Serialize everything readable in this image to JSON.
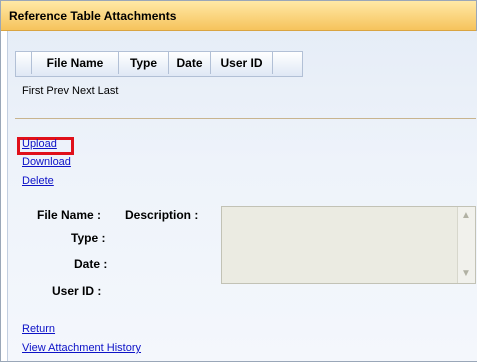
{
  "window": {
    "title": "Reference Table Attachments"
  },
  "table": {
    "columns": [
      "File Name",
      "Type",
      "Date",
      "User ID"
    ]
  },
  "pager": {
    "first": "First",
    "prev": "Prev",
    "next": "Next",
    "last": "Last"
  },
  "actions": {
    "upload": "Upload",
    "download": "Download",
    "delete": "Delete"
  },
  "details": {
    "file_name_label": "File Name :",
    "description_label": "Description :",
    "type_label": "Type :",
    "date_label": "Date :",
    "user_id_label": "User ID :"
  },
  "footer": {
    "return": "Return",
    "history": "View Attachment History"
  },
  "colors": {
    "highlight": "#e0101a",
    "link": "#0d12c7",
    "title_bar": "#f6c35c"
  },
  "icons": {
    "scroll_up": "chevron-up-icon",
    "scroll_down": "chevron-down-icon"
  }
}
